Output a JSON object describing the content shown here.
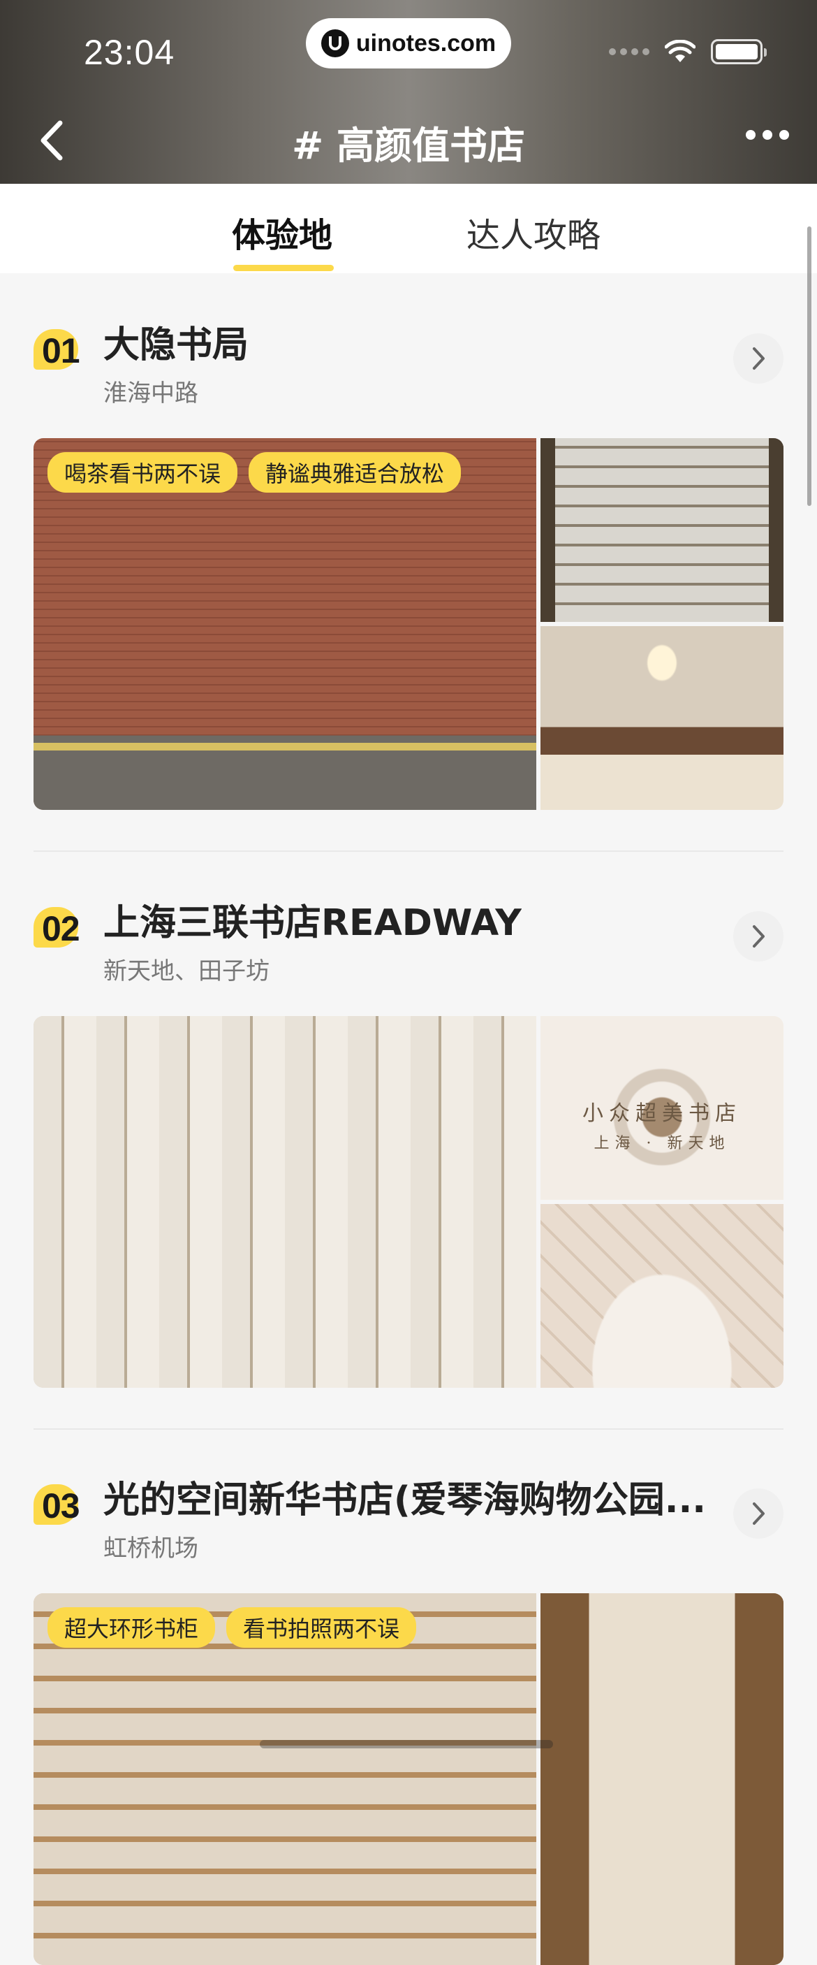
{
  "status_bar": {
    "time": "23:04",
    "url": "uinotes.com"
  },
  "nav": {
    "title": "# 高颜值书店"
  },
  "tabs": [
    {
      "label": "体验地",
      "active": true
    },
    {
      "label": "达人攻略",
      "active": false
    }
  ],
  "places": [
    {
      "rank": "01",
      "name": "大隐书局",
      "area": "淮海中路",
      "tags": [
        "喝茶看书两不误",
        "静谧典雅适合放松"
      ]
    },
    {
      "rank": "02",
      "name": "上海三联书店READWAY",
      "area": "新天地、田子坊",
      "tags": [],
      "photo_text": {
        "line1": "小众超美书店",
        "line2": "上海 · 新天地"
      }
    },
    {
      "rank": "03",
      "name": "光的空间新华书店(爱琴海购物公园...",
      "area": "虹桥机场",
      "tags": [
        "超大环形书柜",
        "看书拍照两不误"
      ]
    }
  ],
  "colors": {
    "accent": "#fcd94a",
    "header_bg": "#6e6a64"
  }
}
